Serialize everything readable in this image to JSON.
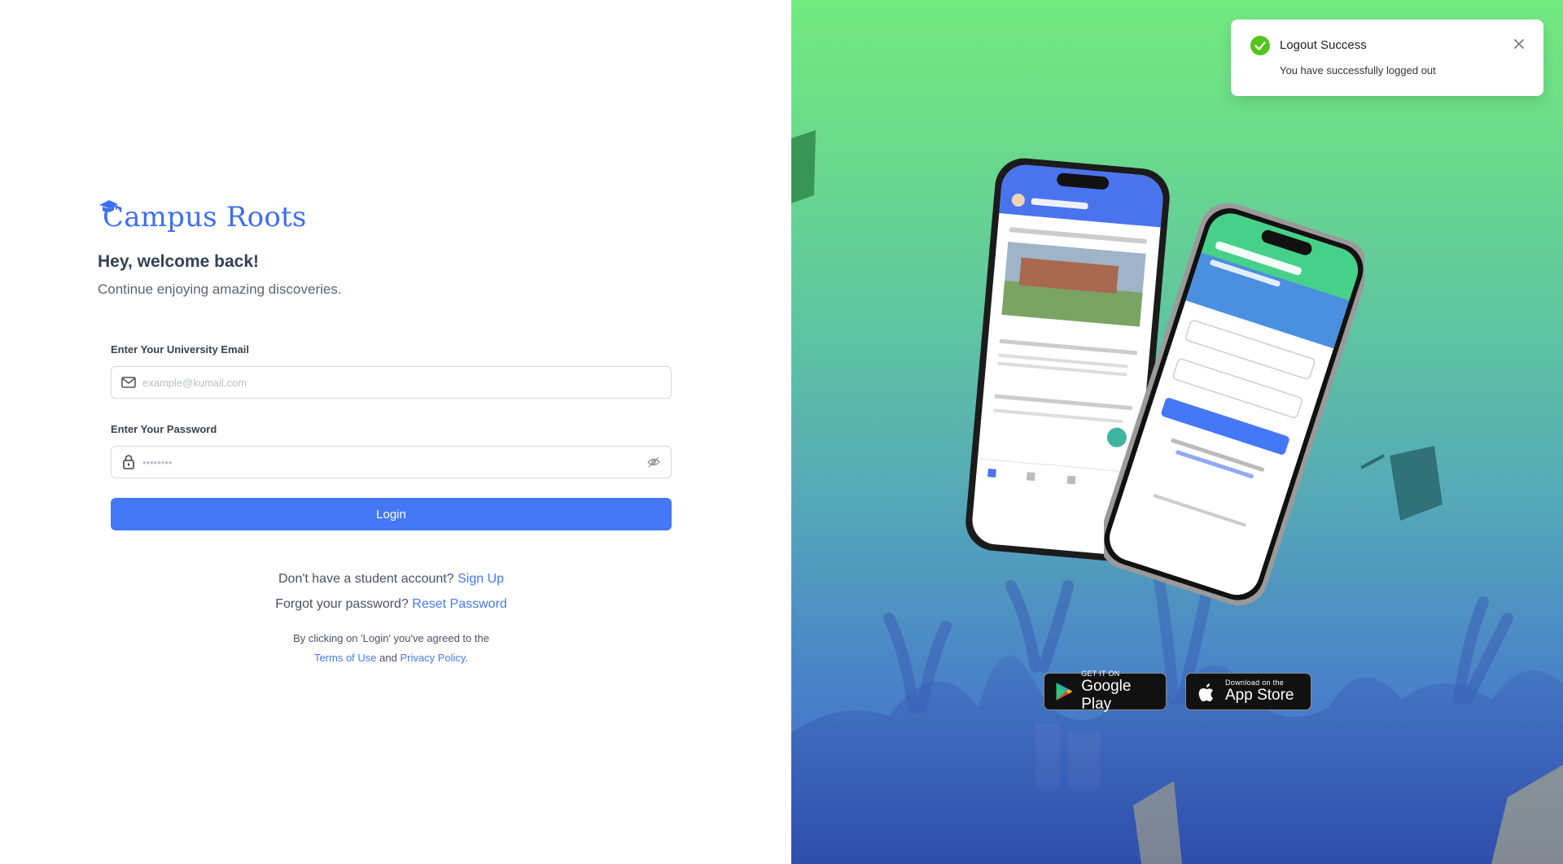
{
  "brand": {
    "name": "Campus Roots",
    "color": "#3e6ef5"
  },
  "login": {
    "heading": "Hey, welcome back!",
    "subheading": "Continue enjoying amazing discoveries.",
    "email_label": "Enter Your University Email",
    "email_placeholder": "example@kumail.com",
    "password_label": "Enter Your Password",
    "password_placeholder": "••••••••",
    "login_button": "Login",
    "signup_prompt": "Don't have a student account?",
    "signup_link": "Sign Up",
    "forgot_prompt": "Forgot your password?",
    "forgot_link": "Reset Password",
    "legal_line1": "By clicking on 'Login' you've agreed to the",
    "terms_link": "Terms of Use",
    "legal_and": "and",
    "privacy_link": "Privacy Policy",
    "legal_end": "."
  },
  "promo": {
    "google_play_small": "GET IT ON",
    "google_play_big": "Google Play",
    "app_store_small": "Download on the",
    "app_store_big": "App Store"
  },
  "toast": {
    "title": "Logout Success",
    "message": "You have successfully logged out",
    "status_color": "#52c41a"
  },
  "icons": {
    "email": "mail-icon",
    "password": "lock-icon",
    "toggle": "eye-off-icon",
    "toast_status": "check-circle-icon",
    "toast_close": "close-icon"
  }
}
